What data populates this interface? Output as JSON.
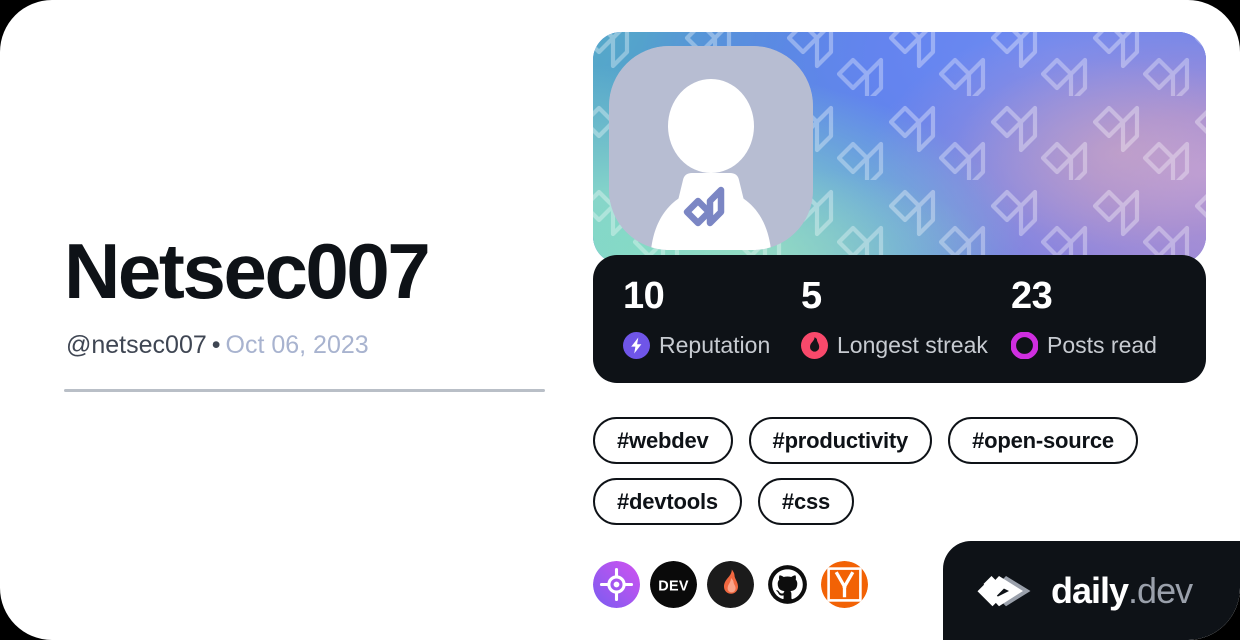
{
  "card": {
    "background_color": "#ffffff",
    "page_background_color": "#000000"
  },
  "profile": {
    "name": "Netsec007",
    "handle": "@netsec007",
    "separator": "•",
    "joined_date": "Oct 06, 2023",
    "avatar_alt": "default-avatar-person-at-laptop"
  },
  "cover": {
    "alt": "gradient-cover-with-daily-dev-pattern",
    "gradient_from": "#56a9c9",
    "gradient_mid": "#5a84e6",
    "gradient_to": "#8c84dc"
  },
  "stats": {
    "background_color": "#0e1217",
    "items": [
      {
        "value": "10",
        "label": "Reputation",
        "icon": "bolt-icon",
        "icon_color": "#6f55e8"
      },
      {
        "value": "5",
        "label": "Longest streak",
        "icon": "flame-icon",
        "icon_color": "#f8496b"
      },
      {
        "value": "23",
        "label": "Posts read",
        "icon": "ring-icon",
        "icon_color": "#cf2ee0"
      }
    ]
  },
  "tags": [
    {
      "label": "#webdev"
    },
    {
      "label": "#productivity"
    },
    {
      "label": "#open-source"
    },
    {
      "label": "#devtools"
    },
    {
      "label": "#css"
    }
  ],
  "sources": [
    {
      "name": "source-icon-target",
      "icon": "target-icon",
      "color": "#b44cf0"
    },
    {
      "name": "source-icon-dev-to",
      "icon": "dev-to-icon",
      "color": "#0a0a0a"
    },
    {
      "name": "source-icon-flame",
      "icon": "flame-source-icon",
      "color": "#1b1b1b"
    },
    {
      "name": "source-icon-github",
      "icon": "github-icon",
      "color": "#0d0d0d"
    },
    {
      "name": "source-icon-hackernews",
      "icon": "hacker-news-icon",
      "color": "#f26205"
    }
  ],
  "branding": {
    "logo": "daily-dev-logo-mark",
    "word_primary": "daily",
    "word_secondary": ".dev",
    "background_color": "#0e1217"
  }
}
